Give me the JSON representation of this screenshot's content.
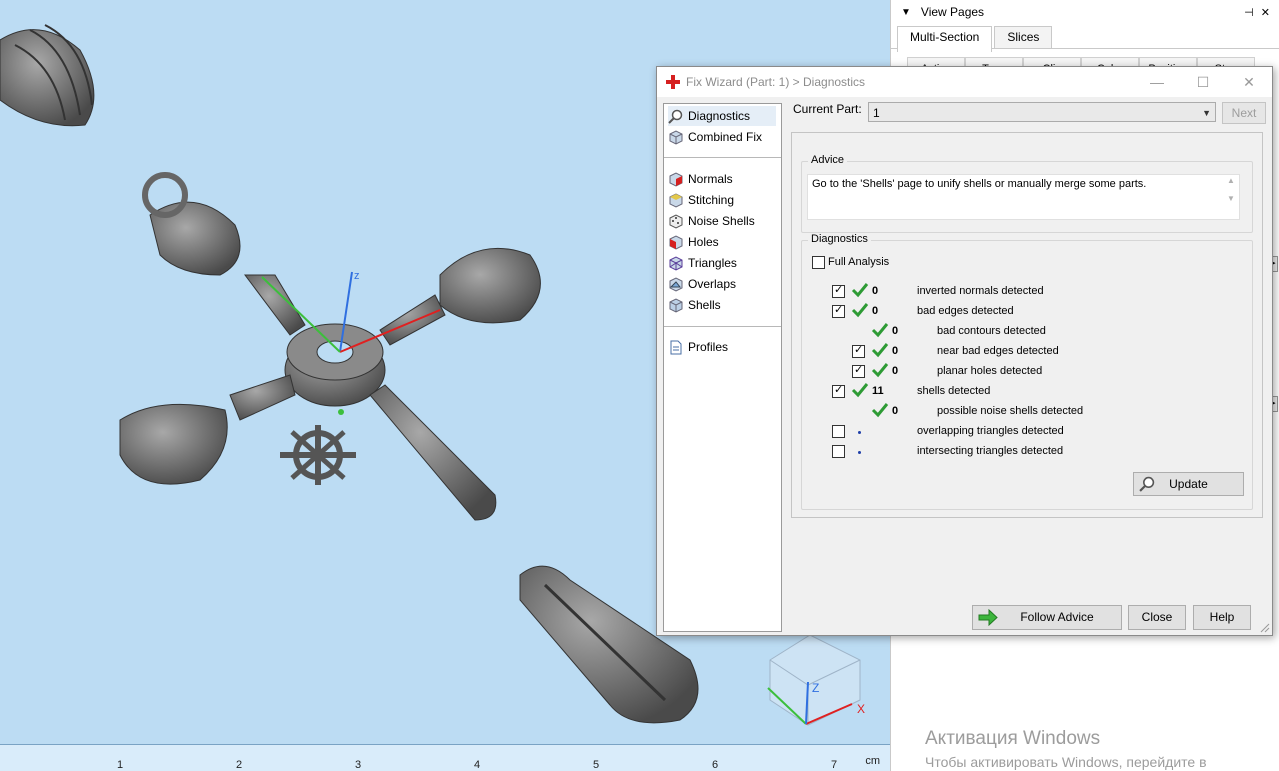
{
  "right_panel": {
    "title": "View Pages",
    "pin_glyphs": "⊣ ✕",
    "tabs": [
      "Multi-Section",
      "Slices"
    ],
    "columns": [
      "Active",
      "Type",
      "Clip",
      "Color",
      "Position",
      "Step"
    ]
  },
  "watermark": {
    "line1": "Активация Windows",
    "line2": "Чтобы активировать Windows, перейдите в"
  },
  "ruler": {
    "ticks": [
      "1",
      "2",
      "3",
      "4",
      "5",
      "6",
      "7"
    ],
    "unit": "cm"
  },
  "viewport": {
    "axis_labels": {
      "z": "z",
      "cube_z": "Z",
      "cube_x": "X"
    }
  },
  "dialog": {
    "title": "Fix Wizard (Part: 1) > Diagnostics",
    "window_controls": {
      "minimize": "—",
      "maximize": "☐",
      "close": "✕"
    },
    "nav": {
      "top": [
        {
          "label": "Diagnostics",
          "icon": "magnifier-icon",
          "selected": true
        },
        {
          "label": "Combined Fix",
          "icon": "cube-icon"
        }
      ],
      "tools": [
        {
          "label": "Normals",
          "icon": "normals-cube-icon"
        },
        {
          "label": "Stitching",
          "icon": "stitching-cube-icon"
        },
        {
          "label": "Noise Shells",
          "icon": "noise-shells-icon"
        },
        {
          "label": "Holes",
          "icon": "holes-cube-icon"
        },
        {
          "label": "Triangles",
          "icon": "triangles-icon"
        },
        {
          "label": "Overlaps",
          "icon": "overlaps-icon"
        },
        {
          "label": "Shells",
          "icon": "shells-icon"
        }
      ],
      "bottom": [
        {
          "label": "Profiles",
          "icon": "document-icon"
        }
      ]
    },
    "current_part_label": "Current Part:",
    "current_part_value": "1",
    "next_label": "Next",
    "advice_title": "Advice",
    "advice_text": "Go to the 'Shells' page to unify shells or manually merge some parts.",
    "diagnostics_title": "Diagnostics",
    "full_analysis_label": "Full Analysis",
    "full_analysis_checked": false,
    "rows": [
      {
        "checked": true,
        "status": "ok",
        "count": "0",
        "label": "inverted normals detected",
        "indent": 0
      },
      {
        "checked": true,
        "status": "ok",
        "count": "0",
        "label": "bad edges detected",
        "indent": 0
      },
      {
        "checkbox": false,
        "status": "ok",
        "count": "0",
        "label": "bad contours detected",
        "indent": 1
      },
      {
        "checked": true,
        "status": "ok",
        "count": "0",
        "label": "near bad edges detected",
        "indent": 1
      },
      {
        "checked": true,
        "status": "ok",
        "count": "0",
        "label": "planar holes detected",
        "indent": 1
      },
      {
        "checked": true,
        "status": "ok",
        "count": "11",
        "label": "shells detected",
        "indent": 0
      },
      {
        "checkbox": false,
        "status": "ok",
        "count": "0",
        "label": "possible noise shells detected",
        "indent": 1
      },
      {
        "checked": false,
        "status": "none",
        "count": "",
        "label": "overlapping triangles detected",
        "indent": 0
      },
      {
        "checked": false,
        "status": "none",
        "count": "",
        "label": "intersecting triangles detected",
        "indent": 0
      }
    ],
    "update_label": "Update",
    "follow_advice_label": "Follow Advice",
    "close_label": "Close",
    "help_label": "Help",
    "colors": {
      "check_green": "#2e9b35",
      "accent_red": "#d62020",
      "axis_x": "#e02020",
      "axis_y": "#3cbf3c",
      "axis_z": "#2f6fe0"
    }
  }
}
